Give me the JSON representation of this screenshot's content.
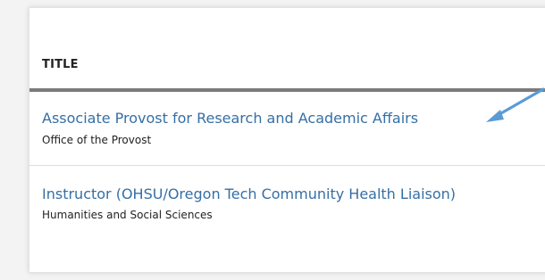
{
  "table": {
    "column_header": "TITLE",
    "rows": [
      {
        "title": "Associate Provost for Research and Academic Affairs",
        "department": "Office of the Provost"
      },
      {
        "title": "Instructor (OHSU/Oregon Tech Community Health Liaison)",
        "department": "Humanities and Social Sciences"
      }
    ]
  },
  "colors": {
    "link": "#356fa6",
    "annotation_arrow": "#5b9bd5",
    "header_rule": "#7a7a7a"
  },
  "annotation": {
    "icon": "arrow-pointer-icon"
  }
}
